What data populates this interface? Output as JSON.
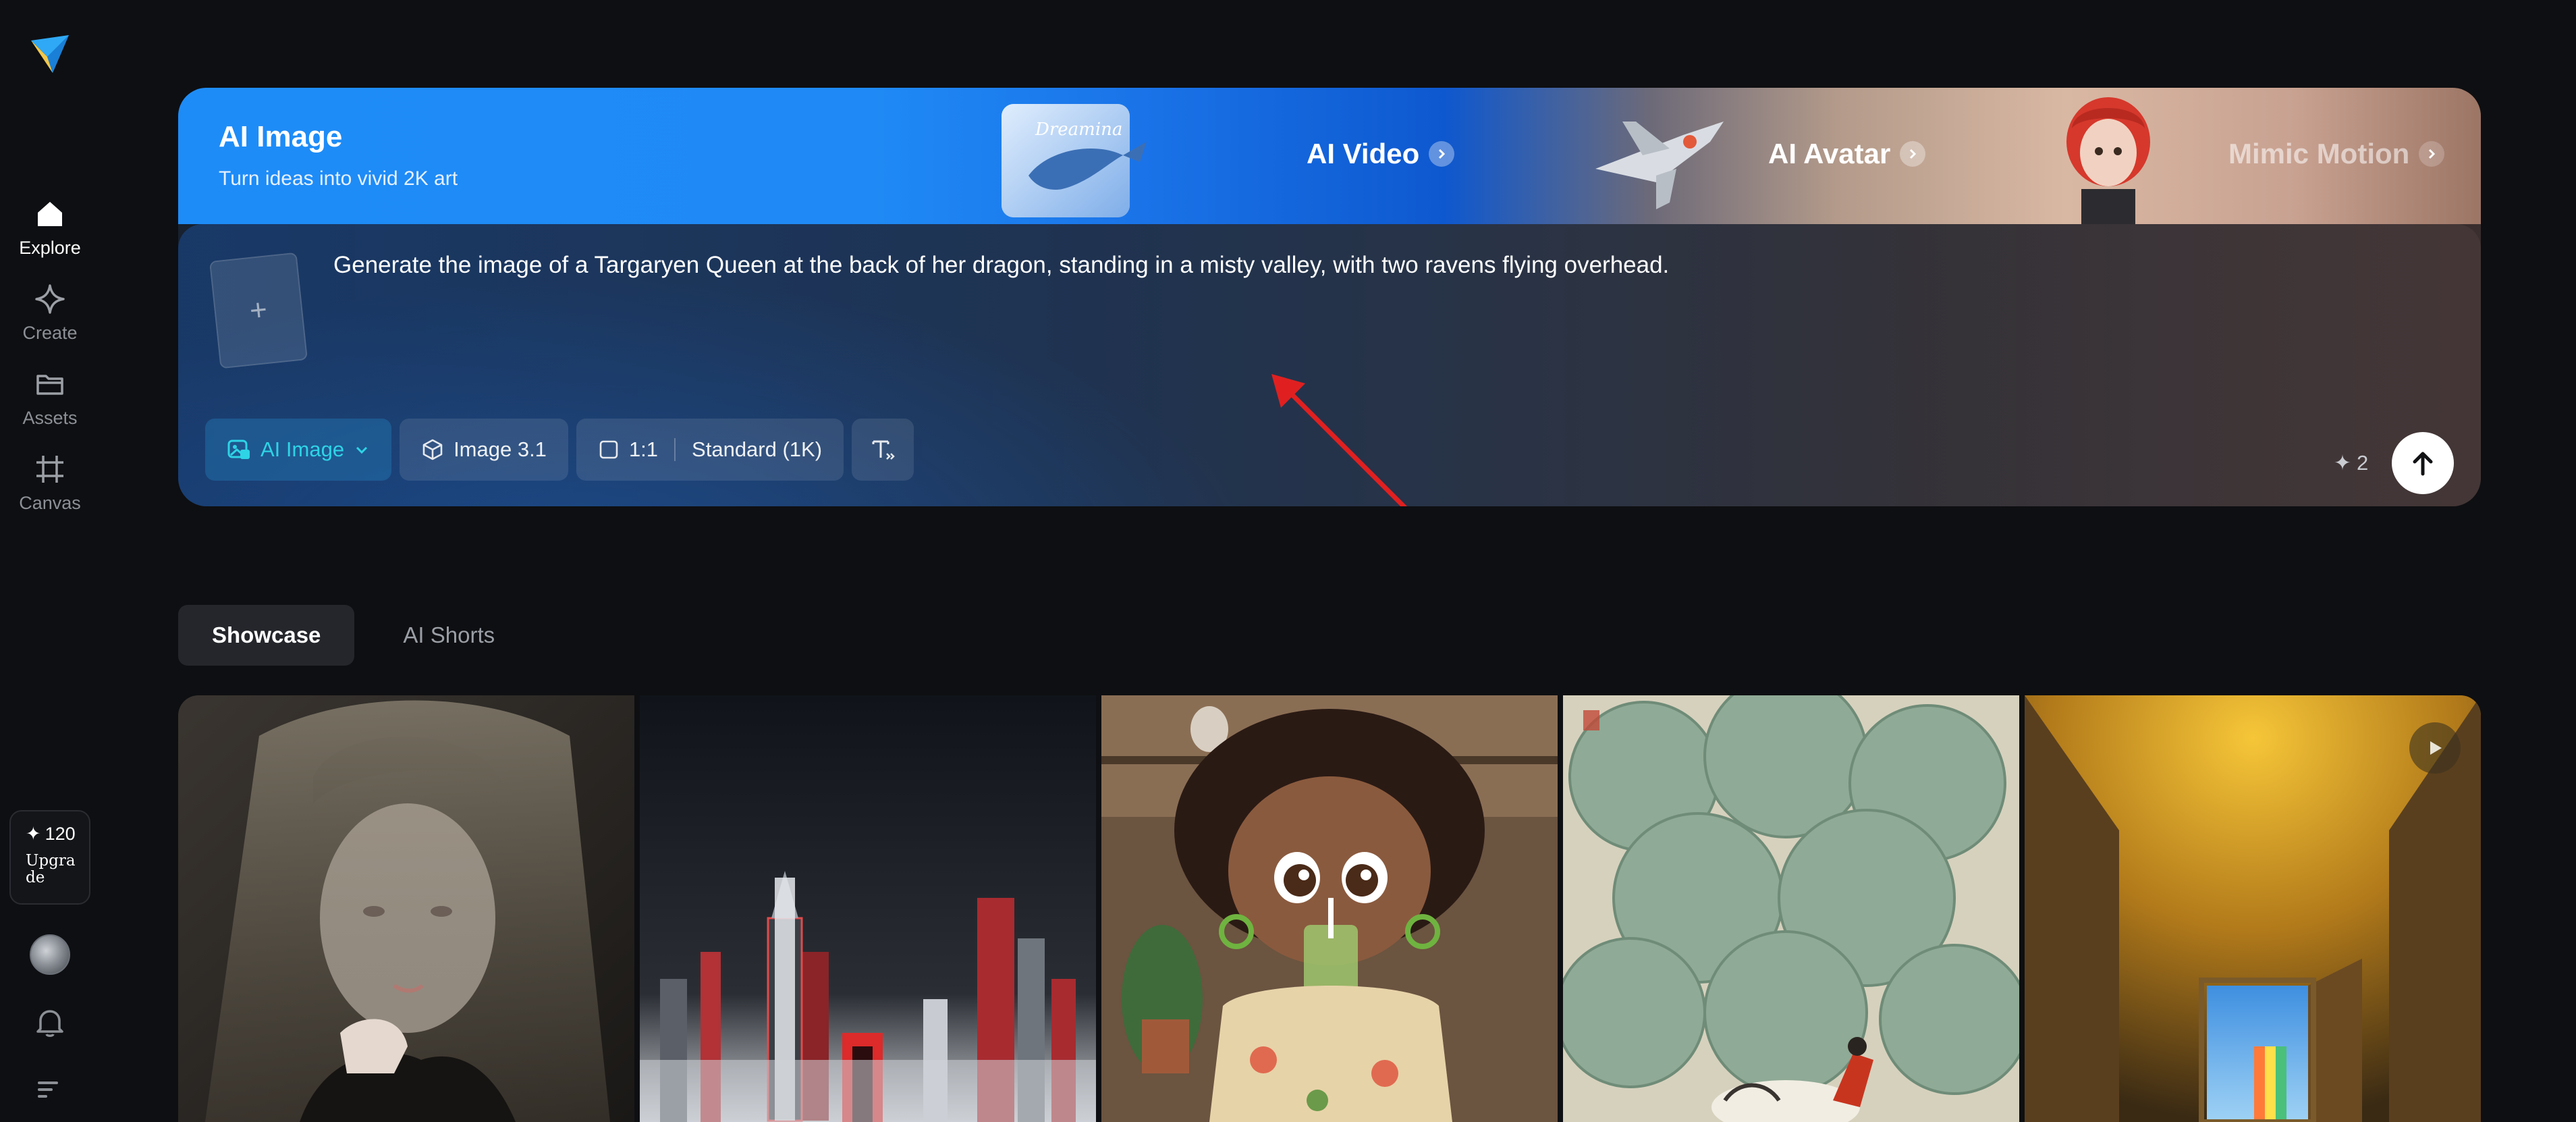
{
  "sidebar": {
    "logo_icon": "paper-plane-logo",
    "items": [
      {
        "label": "Explore",
        "icon": "home-icon",
        "active": true
      },
      {
        "label": "Create",
        "icon": "sparkle-diamond-icon",
        "active": false
      },
      {
        "label": "Assets",
        "icon": "folder-icon",
        "active": false
      },
      {
        "label": "Canvas",
        "icon": "crop-frame-icon",
        "active": false
      }
    ],
    "credits": "120",
    "upgrade_label": "Upgrade"
  },
  "hero": {
    "title": "AI Image",
    "subtitle": "Turn ideas into vivid 2K art",
    "features": [
      {
        "label": "AI Video",
        "enabled": true
      },
      {
        "label": "AI Avatar",
        "enabled": true
      },
      {
        "label": "Mimic Motion",
        "enabled": false
      }
    ],
    "thumb_caption": "Dreamina",
    "prompt": "Generate the image of a Targaryen Queen at the back of her dragon, standing in a misty valley, with two ravens flying overhead.",
    "toolbar": {
      "mode": "AI Image",
      "model": "Image 3.1",
      "ratio": "1:1",
      "quality": "Standard (1K)"
    },
    "cost": "2",
    "colors": {
      "accent": "#2ed3e6",
      "banner_blue": "#1e8cf7",
      "annotation_arrow": "#e02020"
    }
  },
  "tabs": [
    {
      "label": "Showcase",
      "active": true
    },
    {
      "label": "AI Shorts",
      "active": false
    }
  ],
  "gallery": [
    {
      "subject": "veiled-man-portrait"
    },
    {
      "subject": "red-city-skyline"
    },
    {
      "subject": "cartoon-girl-drinking"
    },
    {
      "subject": "green-foliage-rider"
    },
    {
      "subject": "golden-hallway-door",
      "has_video": true
    }
  ]
}
